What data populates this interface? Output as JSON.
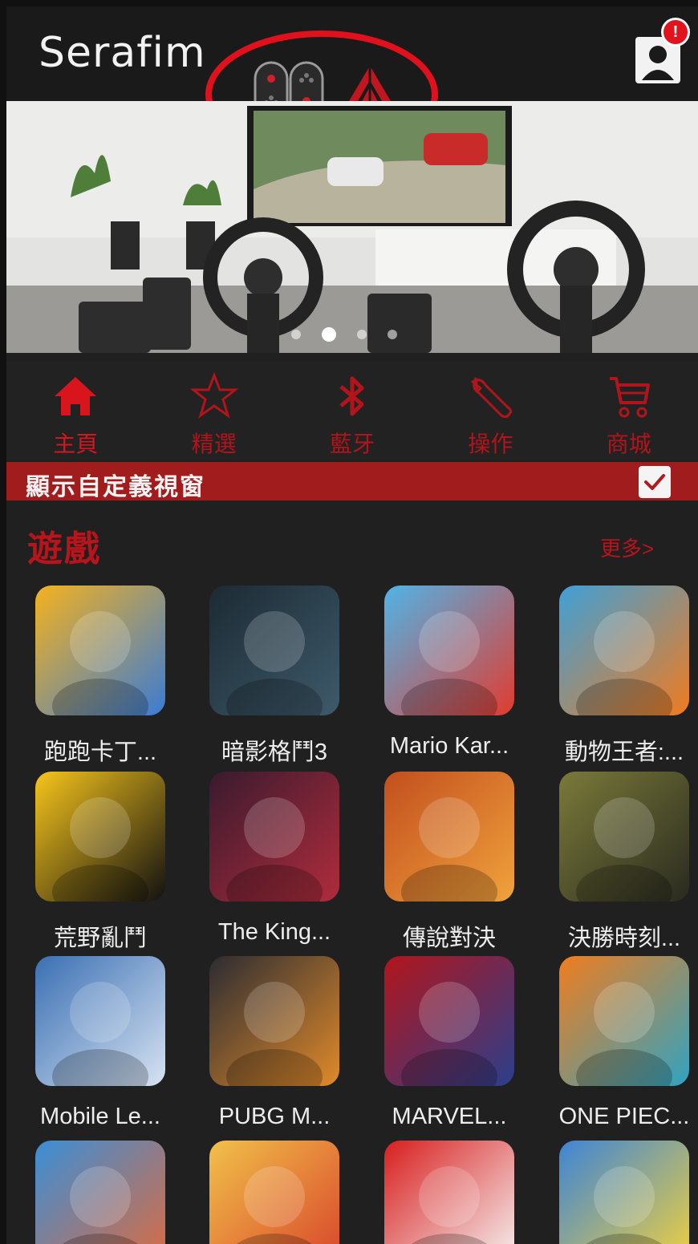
{
  "app": {
    "brand": "Serafim"
  },
  "header": {
    "notification_badge": "!",
    "icons": [
      "joycon-icon",
      "triangle-logo-icon",
      "profile-icon"
    ]
  },
  "banner": {
    "slides": 4,
    "active_slide": 2
  },
  "nav": {
    "items": [
      {
        "label": "主頁",
        "icon": "home-icon",
        "active": true
      },
      {
        "label": "精選",
        "icon": "star-icon",
        "active": false
      },
      {
        "label": "藍牙",
        "icon": "bluetooth-icon",
        "active": false
      },
      {
        "label": "操作",
        "icon": "wrench-icon",
        "active": false
      },
      {
        "label": "商城",
        "icon": "cart-icon",
        "active": false
      }
    ]
  },
  "custom_window": {
    "label": "顯示自定義視窗",
    "checked": true
  },
  "games": {
    "title": "遊戲",
    "more": "更多>",
    "items": [
      {
        "name": "跑跑卡丁...",
        "colors": [
          "#f5b21e",
          "#3a7bd5"
        ]
      },
      {
        "name": "暗影格鬥3",
        "colors": [
          "#1c2a33",
          "#3e5a6b"
        ]
      },
      {
        "name": "Mario Kar...",
        "colors": [
          "#4fb4e8",
          "#e23b2f"
        ]
      },
      {
        "name": "動物王者:...",
        "colors": [
          "#3fa0d8",
          "#f07b1f"
        ]
      },
      {
        "name": "荒野亂鬥",
        "colors": [
          "#f7c51b",
          "#111111"
        ]
      },
      {
        "name": "The King...",
        "colors": [
          "#3a1a2e",
          "#b02c3c"
        ]
      },
      {
        "name": "傳說對決",
        "colors": [
          "#c24f1e",
          "#f0a23c"
        ]
      },
      {
        "name": "決勝時刻...",
        "colors": [
          "#7a7a3a",
          "#2a2a20"
        ]
      },
      {
        "name": "Mobile Le...",
        "colors": [
          "#3a6fb3",
          "#d7e3f2"
        ]
      },
      {
        "name": "PUBG M...",
        "colors": [
          "#2c2c32",
          "#e08a2a"
        ]
      },
      {
        "name": "MARVEL...",
        "colors": [
          "#b2151c",
          "#2b3f8c"
        ]
      },
      {
        "name": "ONE PIEC...",
        "colors": [
          "#f07d1e",
          "#30a3c2"
        ]
      },
      {
        "name": "",
        "colors": [
          "#3a8fd8",
          "#e06a3c"
        ]
      },
      {
        "name": "",
        "colors": [
          "#f2c14a",
          "#d8432a"
        ]
      },
      {
        "name": "",
        "colors": [
          "#d81e1e",
          "#f7f7f7"
        ]
      },
      {
        "name": "",
        "colors": [
          "#3d84d6",
          "#f4d23c"
        ]
      }
    ]
  }
}
